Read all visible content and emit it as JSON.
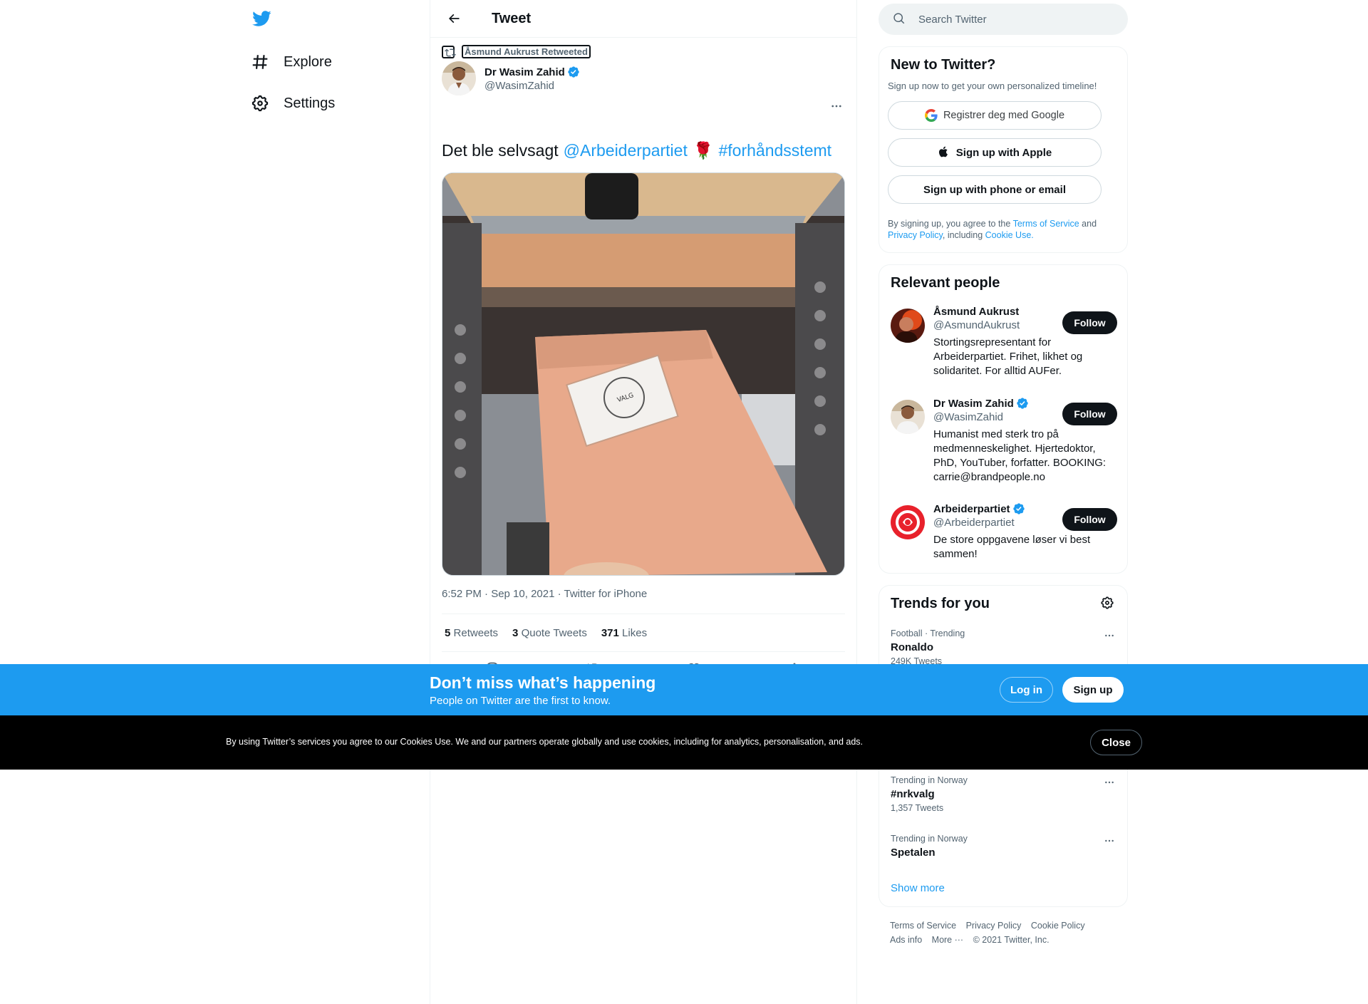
{
  "nav": {
    "items": [
      {
        "label": "Explore",
        "icon": "hashtag-icon"
      },
      {
        "label": "Settings",
        "icon": "gear-icon"
      }
    ]
  },
  "header": {
    "title": "Tweet"
  },
  "tweet": {
    "retweeted_by": "Åsmund Aukrust Retweeted",
    "author_name": "Dr Wasim Zahid",
    "author_handle": "@WasimZahid",
    "text_plain": "Det ble selvsagt",
    "mention": "@Arbeiderpartiet",
    "emoji": "🌹",
    "hashtag": "#forhåndsstemt",
    "meta": "6:52 PM · Sep 10, 2021 · Twitter for iPhone",
    "stats": {
      "retweets_count": "5",
      "retweets_label": "Retweets",
      "quotes_count": "3",
      "quotes_label": "Quote Tweets",
      "likes_count": "371",
      "likes_label": "Likes"
    }
  },
  "search": {
    "placeholder": "Search Twitter"
  },
  "new_to_twitter": {
    "title": "New to Twitter?",
    "subtitle": "Sign up now to get your own personalized timeline!",
    "google_label": "Registrer deg med Google",
    "apple_label": "Sign up with Apple",
    "email_label": "Sign up with phone or email",
    "legal_1": "By signing up, you agree to the",
    "legal_tos": "Terms of Service",
    "legal_and": "and",
    "legal_privacy": "Privacy Policy",
    "legal_including": ", including",
    "legal_cookie": "Cookie Use."
  },
  "relevant": {
    "title": "Relevant people",
    "follow_label": "Follow",
    "people": [
      {
        "name": "Åsmund Aukrust",
        "handle": "@AsmundAukrust",
        "bio": "Stortingsrepresentant for Arbeiderpartiet. Frihet, likhet og solidaritet. For alltid AUFer."
      },
      {
        "name": "Dr Wasim Zahid",
        "handle": "@WasimZahid",
        "bio": "Humanist med sterk tro på medmenneskelighet. Hjertedoktor, PhD, YouTuber, forfatter. BOOKING: carrie@brandpeople.no"
      },
      {
        "name": "Arbeiderpartiet",
        "handle": "@Arbeiderpartiet",
        "bio": "De store oppgavene løser vi best sammen!"
      }
    ]
  },
  "trends": {
    "title": "Trends for you",
    "items": [
      {
        "context": "Football · Trending",
        "name": "Ronaldo",
        "count": "249K Tweets"
      },
      {
        "context": "Trending in Norway",
        "name": "#nrkvalg",
        "count": "1,357 Tweets"
      },
      {
        "context": "Trending in Norway",
        "name": "Spetalen",
        "count": ""
      }
    ],
    "show_more": "Show more"
  },
  "footer": {
    "links": [
      "Terms of Service",
      "Privacy Policy",
      "Cookie Policy",
      "Ads info",
      "More ···"
    ],
    "copyright": "© 2021 Twitter, Inc."
  },
  "banner": {
    "title": "Don’t miss what’s happening",
    "subtitle": "People on Twitter are the first to know.",
    "login": "Log in",
    "signup": "Sign up"
  },
  "cookie": {
    "text": "By using Twitter’s services you agree to our Cookies Use. We and our partners operate globally and use cookies, including for analytics, personalisation, and ads.",
    "close": "Close"
  },
  "colors": {
    "accent": "#1d9bf0",
    "text": "#0f1419",
    "muted": "#536471",
    "banner": "#1d9bf0",
    "cookie": "#000000"
  }
}
